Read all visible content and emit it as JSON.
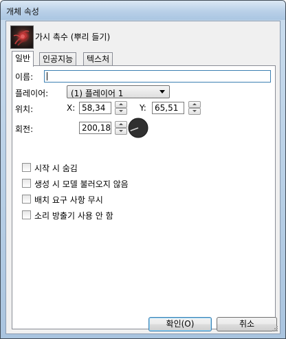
{
  "window": {
    "title": "개체 속성"
  },
  "header": {
    "object_name": "가시 촉수 (뿌리 들기)",
    "icon": "tentacle-unit-icon"
  },
  "tabs": [
    {
      "label": "일반",
      "active": true
    },
    {
      "label": "인공지능",
      "active": false
    },
    {
      "label": "텍스처",
      "active": false
    }
  ],
  "general": {
    "name_label": "이름:",
    "name_value": "",
    "player_label": "플레이어:",
    "player_value": "(1) 플레이어 1",
    "position_label": "위치:",
    "x_label": "X:",
    "x_value": "58,34",
    "y_label": "Y:",
    "y_value": "65,51",
    "rotation_label": "회전:",
    "rotation_value": "200,18",
    "rotation_degrees": 200.18
  },
  "options": [
    {
      "label": "시작 시 숨김",
      "checked": false
    },
    {
      "label": "생성 시 모델 불러오지 않음",
      "checked": false
    },
    {
      "label": "배치 요구 사항 무시",
      "checked": false
    },
    {
      "label": "소리 방출기 사용 안 함",
      "checked": false
    }
  ],
  "buttons": {
    "ok_label": "확인(O)",
    "cancel_label": "취소"
  }
}
